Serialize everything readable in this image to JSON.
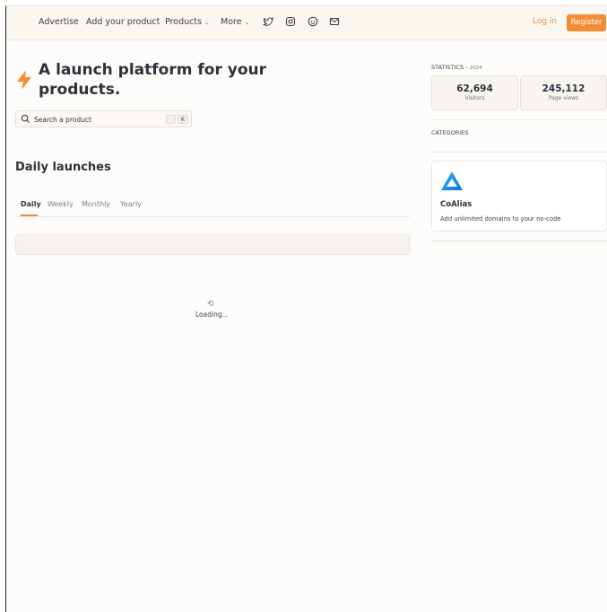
{
  "header": {
    "nav": [
      {
        "label": "Advertise"
      },
      {
        "label": "Add your product"
      },
      {
        "label": "Products"
      },
      {
        "label": "More"
      }
    ],
    "social_icons": [
      "twitter-icon",
      "instagram-icon",
      "reddit-icon",
      "mail-icon"
    ],
    "login_label": "Log in",
    "register_label": "Register"
  },
  "hero": {
    "title": "A launch platform for your products.",
    "search_placeholder": "Search a product",
    "search_shortcut": "K"
  },
  "launches": {
    "title": "Daily launches",
    "tabs": [
      {
        "label": "Daily",
        "active": true
      },
      {
        "label": "Weekly"
      },
      {
        "label": "Monthly"
      },
      {
        "label": "Yearly"
      }
    ],
    "loading_text": "Loading..."
  },
  "sidebar": {
    "stats_heading": "STATISTICS -",
    "stats_year": "2024",
    "stats": [
      {
        "value": "62,694",
        "label": "Visitors"
      },
      {
        "value": "245,112",
        "label": "Page views"
      }
    ],
    "categories_heading": "CATEGORIES",
    "ad": {
      "title": "CoAlias",
      "description": "Add unlimited domains to your no-code"
    }
  },
  "colors": {
    "accent": "#f48b35",
    "brand_blue": "#1b8ff0"
  }
}
